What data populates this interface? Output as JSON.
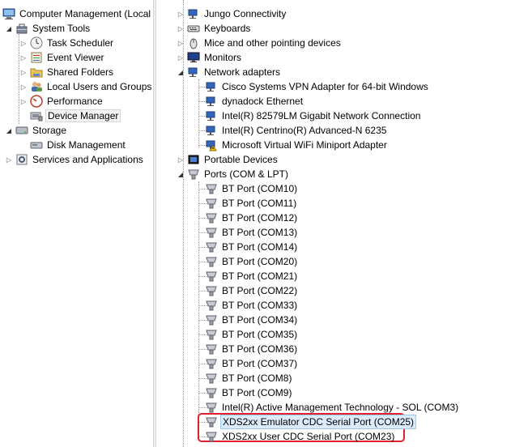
{
  "left_tree": {
    "root": "Computer Management (Local",
    "system_tools": "System Tools",
    "task_scheduler": "Task Scheduler",
    "event_viewer": "Event Viewer",
    "shared_folders": "Shared Folders",
    "local_users": "Local Users and Groups",
    "performance": "Performance",
    "device_manager": "Device Manager",
    "storage": "Storage",
    "disk_management": "Disk Management",
    "services": "Services and Applications"
  },
  "device_tree": {
    "jungo": "Jungo Connectivity",
    "keyboards": "Keyboards",
    "mice": "Mice and other pointing devices",
    "monitors": "Monitors",
    "network_adapters": "Network adapters",
    "network_children": [
      "Cisco Systems VPN Adapter for 64-bit Windows",
      "dynadock Ethernet",
      "Intel(R) 82579LM Gigabit Network Connection",
      "Intel(R) Centrino(R) Advanced-N 6235",
      "Microsoft Virtual WiFi Miniport Adapter"
    ],
    "portable_devices": "Portable Devices",
    "ports": "Ports (COM & LPT)",
    "ports_children": [
      "BT Port (COM10)",
      "BT Port (COM11)",
      "BT Port (COM12)",
      "BT Port (COM13)",
      "BT Port (COM14)",
      "BT Port (COM20)",
      "BT Port (COM21)",
      "BT Port (COM22)",
      "BT Port (COM33)",
      "BT Port (COM34)",
      "BT Port (COM35)",
      "BT Port (COM36)",
      "BT Port (COM37)",
      "BT Port (COM8)",
      "BT Port (COM9)",
      "Intel(R) Active Management Technology - SOL (COM3)",
      "XDS2xx Emulator CDC Serial Port (COM25)",
      "XDS2xx User CDC Serial Port (COM23)"
    ]
  },
  "colors": {
    "highlight_border": "#e0212b",
    "selection": "#dcebfc"
  },
  "icons": {
    "computer": "computer-icon",
    "tools": "toolbox-icon",
    "clock": "clock-icon",
    "viewer": "event-viewer-icon",
    "folders": "shared-folder-icon",
    "users": "users-icon",
    "performance": "gauge-icon",
    "device": "device-manager-icon",
    "storage": "storage-icon",
    "disk": "disk-icon",
    "services": "services-icon",
    "network": "network-adapter-icon",
    "port": "serial-port-icon"
  }
}
